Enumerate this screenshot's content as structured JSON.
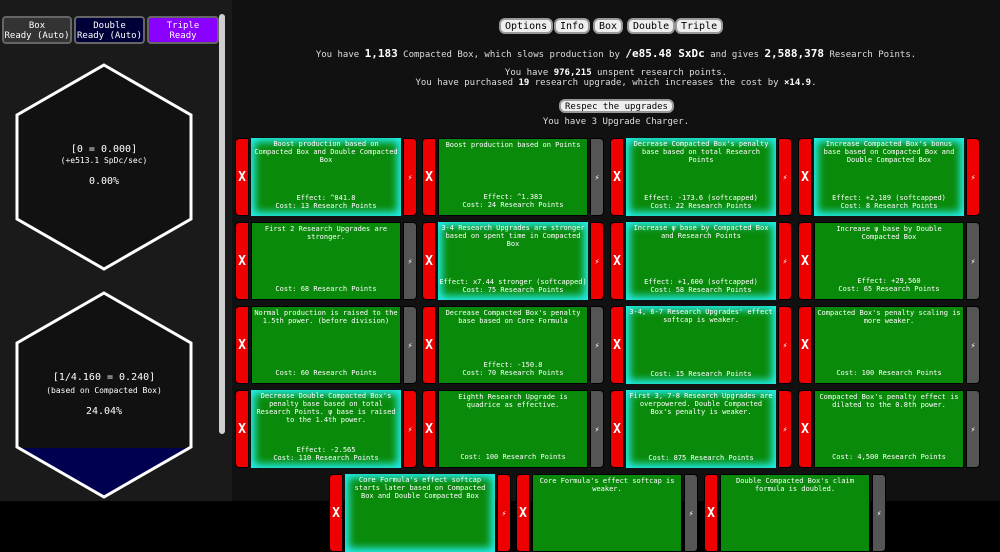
{
  "modes": [
    {
      "name": "Box",
      "status": "Ready (Auto)"
    },
    {
      "name": "Double",
      "status": "Ready (Auto)"
    },
    {
      "name": "Triple",
      "status": "Ready"
    }
  ],
  "hex1": {
    "line1": "[0 = 0.000]",
    "line2": "(+e513.1 SpDc/sec)",
    "line3": "0.00%"
  },
  "hex2": {
    "line1": "[1/4.160 = 0.240]",
    "line2": "(based on Compacted Box)",
    "line3": "24.04%",
    "fill_fraction": 0.24
  },
  "nav": [
    "Options",
    "Info",
    "Box",
    "Double",
    "Triple"
  ],
  "info": {
    "l1a": "You have",
    "l1_box": "1,183",
    "l1b": "Compacted Box, which slows production by",
    "l1_slow": "/e85.48 SxDc",
    "l1c": "and gives",
    "l1_rp": "2,588,378",
    "l1d": "Research Points.",
    "l2a": "You have",
    "l2_rp": "976,215",
    "l2b": "unspent research points.",
    "l3a": "You have purchased",
    "l3_n": "19",
    "l3b": "research upgrade, which increases the cost by",
    "l3_mult": "×14.9",
    "l3c": ".",
    "respec": "Respec the upgrades",
    "charger": "You have 3 Upgrade Charger."
  },
  "cards": [
    {
      "desc": "Boost production based on Compacted Box and Double Compacted Box",
      "effect": "Effect: ^841.8",
      "cost": "Cost: 13 Research Points",
      "glow": true,
      "charged": true
    },
    {
      "desc": "Boost production based on Points",
      "effect": "Effect: ^1.383",
      "cost": "Cost: 24 Research Points",
      "glow": false,
      "charged": false
    },
    {
      "desc": "Decrease Compacted Box's penalty base based on total Research Points",
      "effect": "Effect: -173.6 (softcapped)",
      "cost": "Cost: 22 Research Points",
      "glow": true,
      "charged": true
    },
    {
      "desc": "Increase Compacted Box's bonus base based on Compacted Box and Double Compacted Box",
      "effect": "Effect: +2,189 (softcapped)",
      "cost": "Cost: 8 Research Points",
      "glow": true,
      "charged": true
    },
    {
      "desc": "First 2 Research Upgrades are stronger.",
      "effect": "",
      "cost": "Cost: 68 Research Points",
      "glow": false,
      "charged": false
    },
    {
      "desc": "3-4 Research Upgrades are stronger based on spent time in Compacted Box",
      "effect": "Effect: x7.44 stronger (softcapped)",
      "cost": "Cost: 75 Research Points",
      "glow": true,
      "charged": true
    },
    {
      "desc": "Increase ψ base by Compacted Box and Research Points",
      "effect": "Effect: +1,600 (softcapped)",
      "cost": "Cost: 58 Research Points",
      "glow": true,
      "charged": true
    },
    {
      "desc": "Increase ψ base by Double Compacted Box",
      "effect": "Effect: +29,560",
      "cost": "Cost: 65 Research Points",
      "glow": false,
      "charged": false
    },
    {
      "desc": "Normal production is raised to the 1.5th power. (before division)",
      "effect": "",
      "cost": "Cost: 60 Research Points",
      "glow": false,
      "charged": false
    },
    {
      "desc": "Decrease Compacted Box's penalty base based on Core Formula",
      "effect": "Effect: -150.8",
      "cost": "Cost: 70 Research Points",
      "glow": false,
      "charged": false
    },
    {
      "desc": "3-4, 6-7 Research Upgrades' effect softcap is weaker.",
      "effect": "",
      "cost": "Cost: 15 Research Points",
      "glow": true,
      "charged": true
    },
    {
      "desc": "Compacted Box's penalty scaling is more weaker.",
      "effect": "",
      "cost": "Cost: 100 Research Points",
      "glow": false,
      "charged": false
    },
    {
      "desc": "Decrease Double Compacted Box's penalty base based on total Research Points. ψ base is raised to the 1.4th power.",
      "effect": "Effect: -2.565",
      "cost": "Cost: 110 Research Points",
      "glow": true,
      "charged": true
    },
    {
      "desc": "Eighth Research Upgrade is quadrice as effective.",
      "effect": "",
      "cost": "Cost: 100 Research Points",
      "glow": false,
      "charged": false
    },
    {
      "desc": "First 3, 7-8 Research Upgrades are overpowered. Double Compacted Box's penalty is weaker.",
      "effect": "",
      "cost": "Cost: 875 Research Points",
      "glow": true,
      "charged": true
    },
    {
      "desc": "Compacted Box's penalty effect is dilated to the 0.8th power.",
      "effect": "",
      "cost": "Cost: 4,500 Research Points",
      "glow": false,
      "charged": false
    },
    {
      "desc": "Core Formula's effect softcap starts later based on Compacted Box and Double Compacted Box",
      "effect": "",
      "cost": "",
      "glow": true,
      "charged": true
    },
    {
      "desc": "Core Formula's effect softcap is weaker.",
      "effect": "",
      "cost": "",
      "glow": false,
      "charged": false
    },
    {
      "desc": "Double Compacted Box's claim formula is doubled.",
      "effect": "",
      "cost": "",
      "glow": false,
      "charged": false
    }
  ],
  "icons": {
    "remove": "X",
    "charge": "lightning-icon"
  }
}
